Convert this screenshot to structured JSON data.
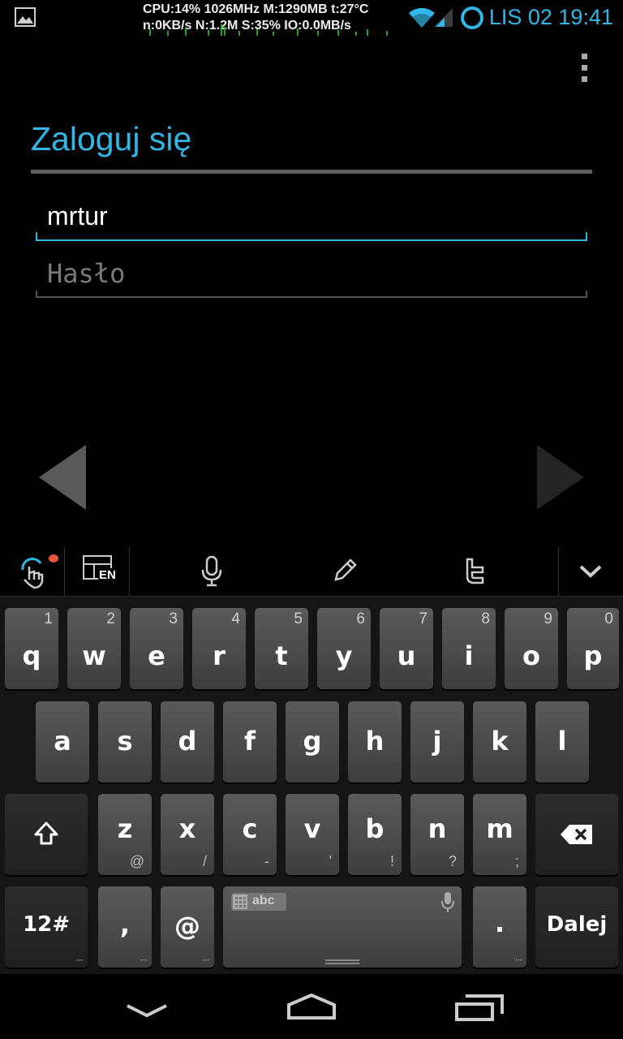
{
  "status_bar": {
    "line1": "CPU:14% 1026MHz M:1290MB t:27°C",
    "line2": "n:0KB/s N:1.2M S:35% IO:0.0MB/s",
    "datetime": "LIS 02 19:41",
    "icons": [
      "gallery-notification-icon",
      "wifi-icon",
      "signal-icon",
      "sync-ring-icon"
    ]
  },
  "screen": {
    "title": "Zaloguj się",
    "username_value": "mrtur",
    "password_placeholder": "Hasło",
    "colors": {
      "accent": "#33b5e5",
      "background": "#000000"
    }
  },
  "keyboard": {
    "toolbar_icons": [
      "swipe-gesture-icon",
      "layout-en-icon",
      "microphone-icon",
      "pencil-icon",
      "twitter-icon",
      "collapse-chevron-icon"
    ],
    "layout_label": "EN",
    "row1": [
      {
        "key": "q",
        "hint": "1"
      },
      {
        "key": "w",
        "hint": "2"
      },
      {
        "key": "e",
        "hint": "3"
      },
      {
        "key": "r",
        "hint": "4"
      },
      {
        "key": "t",
        "hint": "5"
      },
      {
        "key": "y",
        "hint": "6"
      },
      {
        "key": "u",
        "hint": "7"
      },
      {
        "key": "i",
        "hint": "8"
      },
      {
        "key": "o",
        "hint": "9"
      },
      {
        "key": "p",
        "hint": "0"
      }
    ],
    "row2": [
      "a",
      "s",
      "d",
      "f",
      "g",
      "h",
      "j",
      "k",
      "l"
    ],
    "row3": [
      {
        "key": "z",
        "hint": "@"
      },
      {
        "key": "x",
        "hint": "/"
      },
      {
        "key": "c",
        "hint": "-"
      },
      {
        "key": "v",
        "hint": "'"
      },
      {
        "key": "b",
        "hint": "!"
      },
      {
        "key": "n",
        "hint": "?"
      },
      {
        "key": "m",
        "hint": ";"
      }
    ],
    "numbers_label": "12#",
    "comma": ",",
    "at": "@",
    "space_badge": "abc",
    "period": ".",
    "action_label": "Dalej"
  }
}
